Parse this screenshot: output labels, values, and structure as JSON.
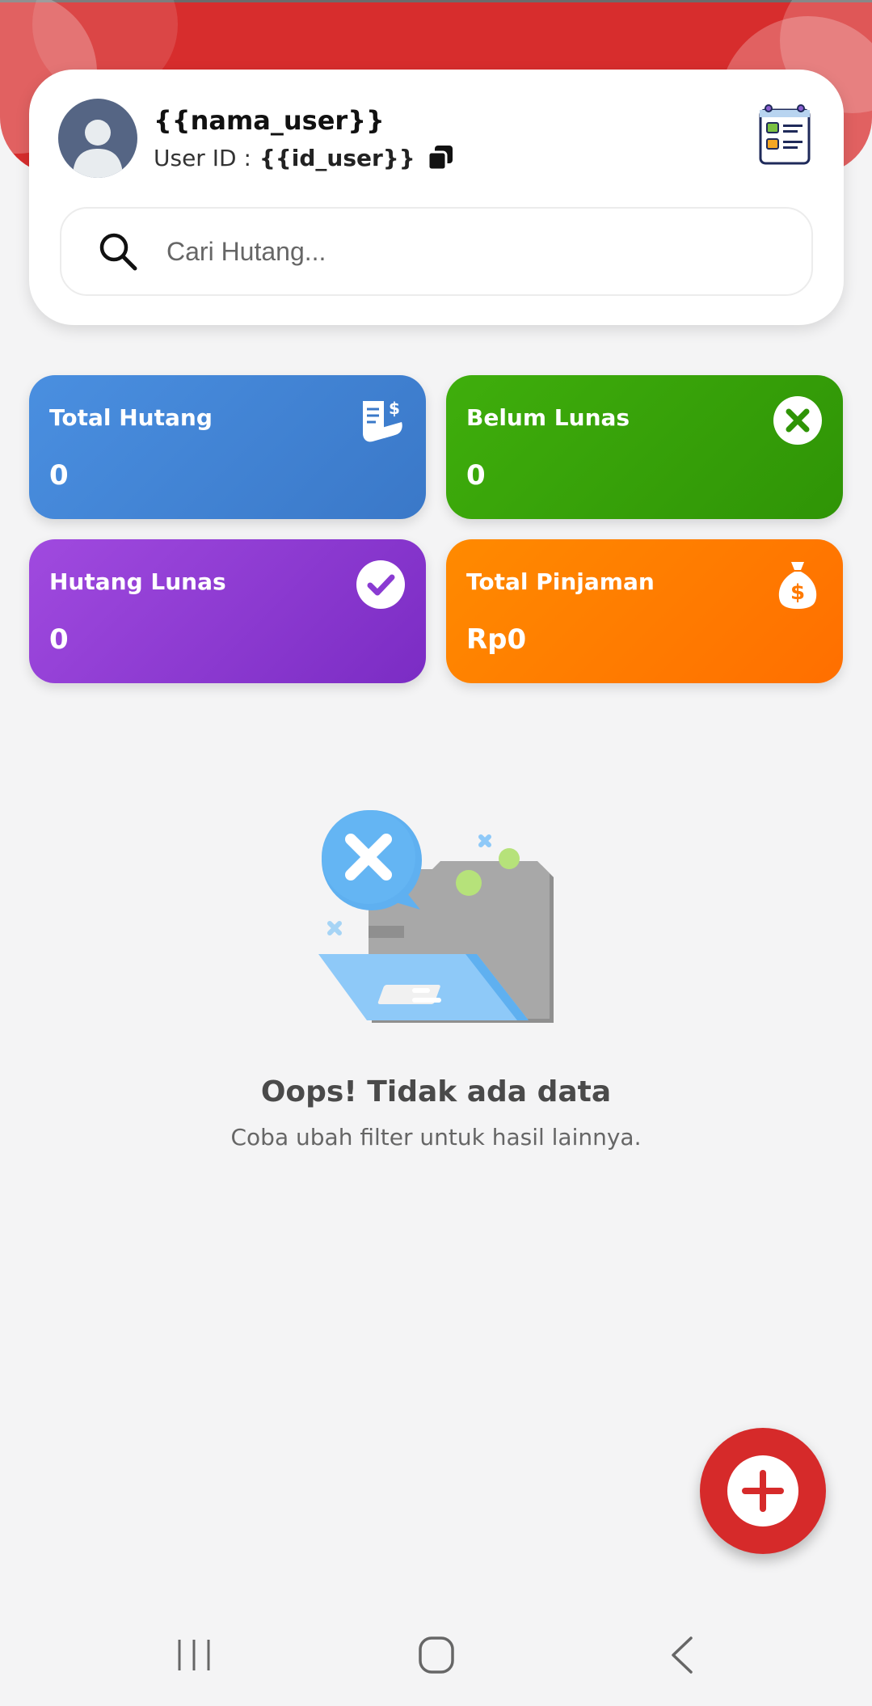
{
  "header": {
    "user_name": "{{nama_user}}",
    "user_id_label": "User ID :",
    "user_id_value": "{{id_user}}"
  },
  "search": {
    "placeholder": "Cari Hutang..."
  },
  "stats": [
    {
      "label": "Total Hutang",
      "value": "0",
      "icon": "receipt-dollar-icon",
      "color": "#4a8fe0"
    },
    {
      "label": "Belum Lunas",
      "value": "0",
      "icon": "x-circle-icon",
      "color": "#3fae0c"
    },
    {
      "label": "Hutang Lunas",
      "value": "0",
      "icon": "check-circle-icon",
      "color": "#a04adf"
    },
    {
      "label": "Total Pinjaman",
      "value": "Rp0",
      "icon": "money-bag-icon",
      "color": "#ff8a00"
    }
  ],
  "empty_state": {
    "title": "Oops! Tidak ada data",
    "subtitle": "Coba ubah filter untuk hasil lainnya.",
    "illustration": "empty-folder-icon"
  },
  "fab": {
    "icon": "plus-icon",
    "color": "#d62a2a"
  },
  "nav": {
    "recents": "recents-icon",
    "home": "home-icon",
    "back": "back-icon"
  },
  "colors": {
    "accent": "#d72d2d",
    "background": "#f4f4f5"
  }
}
